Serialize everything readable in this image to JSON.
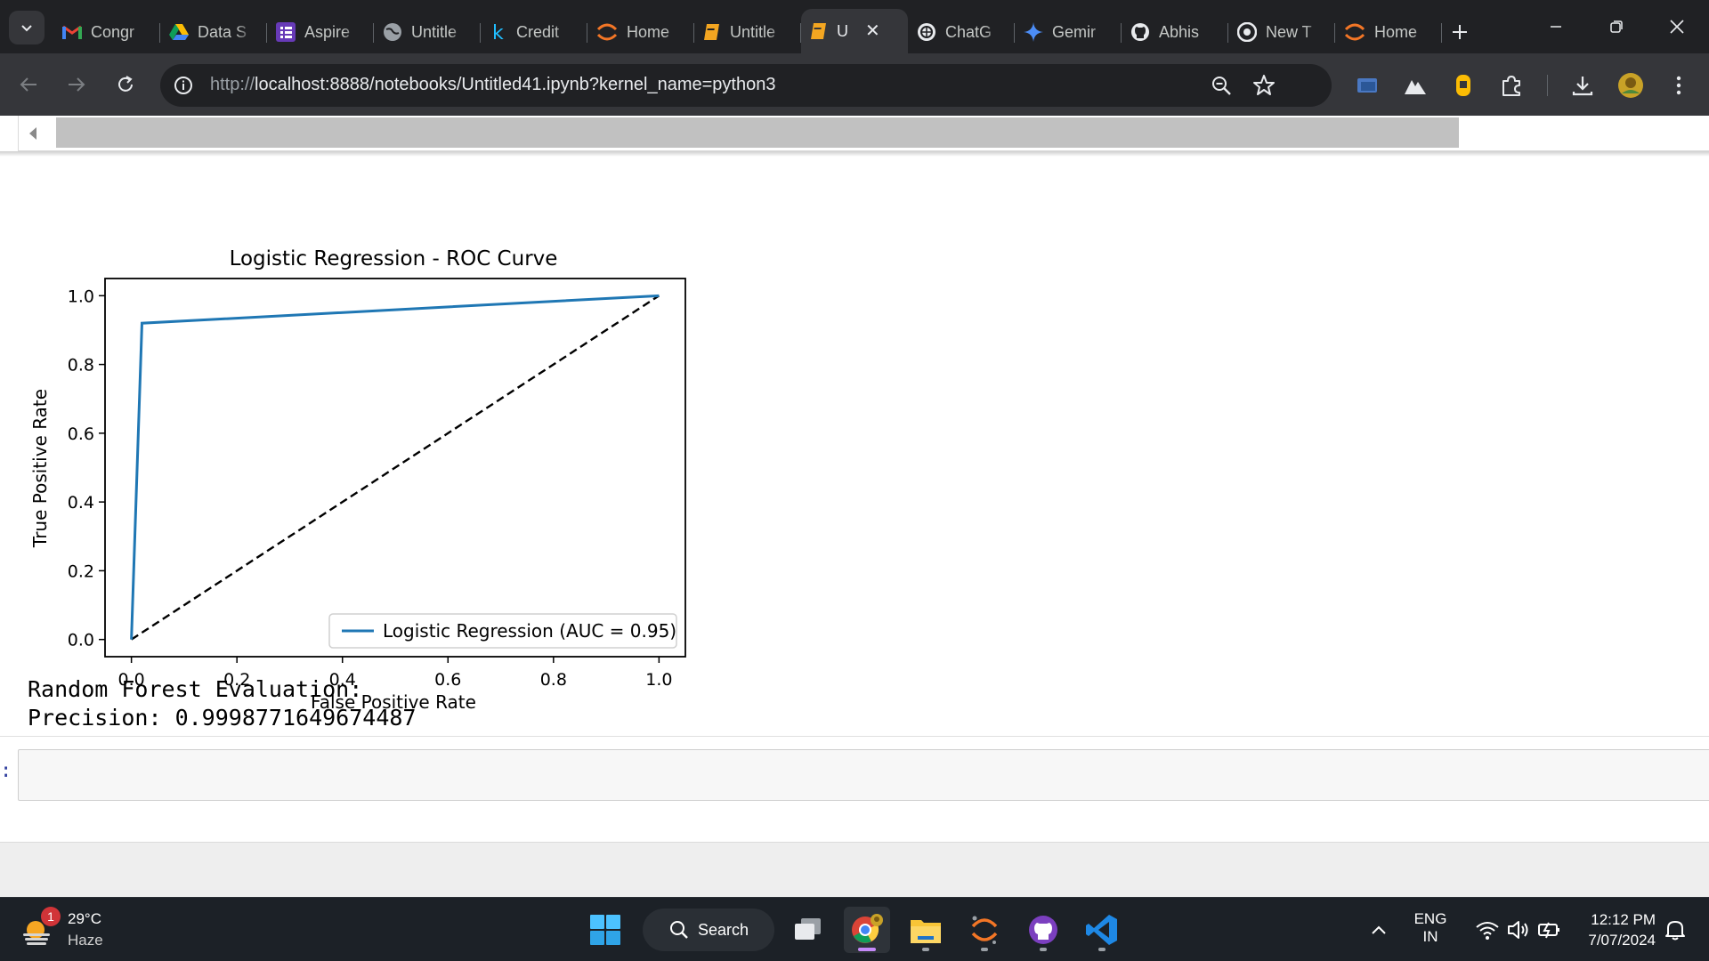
{
  "browser": {
    "tabs": [
      {
        "title": "Congr",
        "icon": "gmail-icon"
      },
      {
        "title": "Data S",
        "icon": "google-drive-icon"
      },
      {
        "title": "Aspire",
        "icon": "forms-icon"
      },
      {
        "title": "Untitle",
        "icon": "globe-icon"
      },
      {
        "title": "Credit",
        "icon": "kaggle-icon"
      },
      {
        "title": "Home",
        "icon": "jupyter-icon"
      },
      {
        "title": "Untitle",
        "icon": "notebook-icon"
      },
      {
        "title": "U",
        "icon": "notebook-icon",
        "active": true
      },
      {
        "title": "ChatG",
        "icon": "chatgpt-icon"
      },
      {
        "title": "Gemir",
        "icon": "gemini-icon"
      },
      {
        "title": "Abhis",
        "icon": "github-icon"
      },
      {
        "title": "New T",
        "icon": "chrome-icon"
      },
      {
        "title": "Home",
        "icon": "jupyter-icon"
      }
    ],
    "address": {
      "host": "localhost",
      "prefix": "http://",
      "rest": ":8888/notebooks/Untitled41.ipynb?kernel_name=python3"
    }
  },
  "plot": {
    "chart_data": {
      "type": "line",
      "title": "Logistic Regression - ROC Curve",
      "xlabel": "False Positive Rate",
      "ylabel": "True Positive Rate",
      "xlim": [
        -0.05,
        1.05
      ],
      "ylim": [
        -0.05,
        1.05
      ],
      "xticks": [
        "0.0",
        "0.2",
        "0.4",
        "0.6",
        "0.8",
        "1.0"
      ],
      "yticks": [
        "0.0",
        "0.2",
        "0.4",
        "0.6",
        "0.8",
        "1.0"
      ],
      "series": [
        {
          "name": "Logistic Regression (AUC = 0.95)",
          "x": [
            0.0,
            0.02,
            1.0
          ],
          "y": [
            0.0,
            0.92,
            1.0
          ],
          "color": "#1f77b4",
          "style": "solid"
        },
        {
          "x": [
            0.0,
            1.0
          ],
          "y": [
            0.0,
            1.0
          ],
          "color": "#000000",
          "style": "dashed"
        }
      ],
      "legend": "lower-right"
    }
  },
  "output": {
    "lines": [
      "Random Forest Evaluation:",
      "Precision: 0.9998771649674487"
    ]
  },
  "cell": {
    "prompt": ":"
  },
  "taskbar": {
    "weather": {
      "badge": "1",
      "temp": "29°C",
      "condition": "Haze"
    },
    "search_label": "Search",
    "lang_top": "ENG",
    "lang_bottom": "IN",
    "time": "12:12 PM",
    "date": "7/07/2024"
  }
}
